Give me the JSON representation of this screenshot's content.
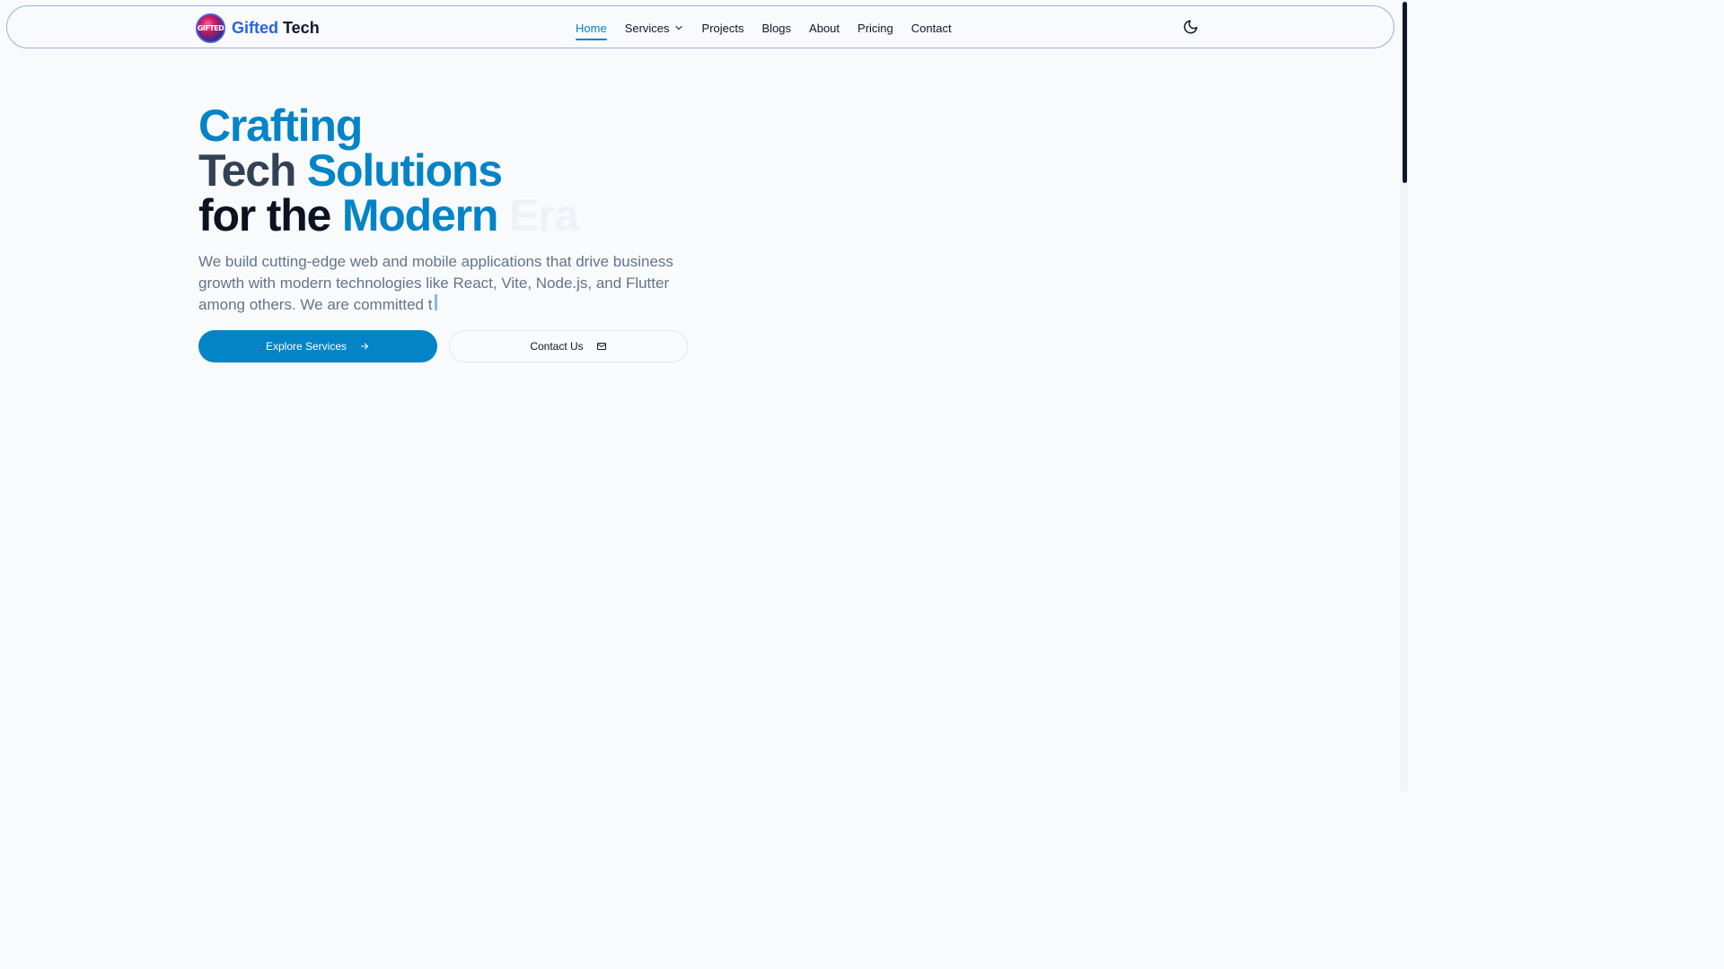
{
  "brand": {
    "logo_text": "GIFTED",
    "name_first": "Gifted",
    "name_second": "Tech"
  },
  "nav": {
    "items": [
      {
        "label": "Home",
        "active": true
      },
      {
        "label": "Services",
        "has_dropdown": true
      },
      {
        "label": "Projects"
      },
      {
        "label": "Blogs"
      },
      {
        "label": "About"
      },
      {
        "label": "Pricing"
      },
      {
        "label": "Contact"
      }
    ],
    "theme_toggle_icon": "moon-icon"
  },
  "hero": {
    "line1": "Crafting",
    "line2_a": "Tech",
    "line2_b": "Solutions",
    "line3_a": "for the",
    "line3_b": "Modern",
    "line3_c": "Era",
    "description": "We build cutting-edge web and mobile applications that drive business growth with modern technologies like React, Vite, Node.js, and Flutter among others. We are committed t"
  },
  "actions": {
    "primary_label": "Explore Services",
    "primary_icon": "arrow-right-icon",
    "secondary_label": "Contact Us",
    "secondary_icon": "mail-icon"
  },
  "colors": {
    "accent": "#0284c7",
    "brand_blue": "#2563eb",
    "text_dark": "#0f172a",
    "text_muted": "#64748b",
    "background": "#f8fafc"
  }
}
